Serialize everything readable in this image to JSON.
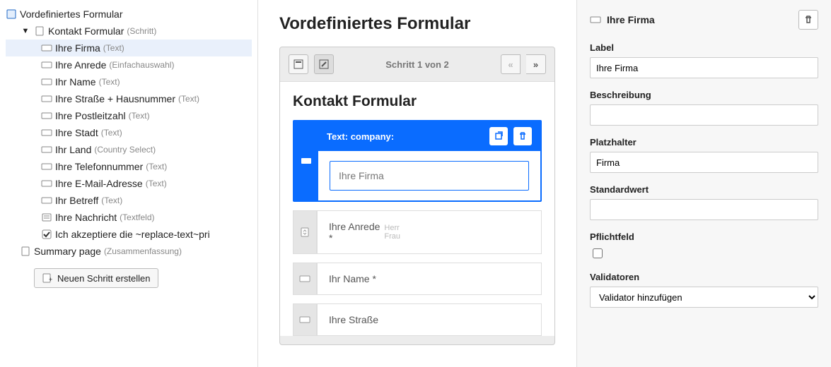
{
  "tree": {
    "root": {
      "label": "Vordefiniertes Formular",
      "type": ""
    },
    "step": {
      "label": "Kontakt Formular",
      "type": "(Schritt)"
    },
    "fields": [
      {
        "label": "Ihre Firma",
        "type": "(Text)",
        "icon": "field",
        "selected": true
      },
      {
        "label": "Ihre Anrede",
        "type": "(Einfachauswahl)",
        "icon": "field"
      },
      {
        "label": "Ihr Name",
        "type": "(Text)",
        "icon": "field"
      },
      {
        "label": "Ihre Straße + Hausnummer",
        "type": "(Text)",
        "icon": "field"
      },
      {
        "label": "Ihre Postleitzahl",
        "type": "(Text)",
        "icon": "field"
      },
      {
        "label": "Ihre Stadt",
        "type": "(Text)",
        "icon": "field"
      },
      {
        "label": "Ihr Land",
        "type": "(Country Select)",
        "icon": "field"
      },
      {
        "label": "Ihre Telefonnummer",
        "type": "(Text)",
        "icon": "field"
      },
      {
        "label": "Ihre E-Mail-Adresse",
        "type": "(Text)",
        "icon": "field"
      },
      {
        "label": "Ihr Betreff",
        "type": "(Text)",
        "icon": "field"
      },
      {
        "label": "Ihre Nachricht",
        "type": "(Textfeld)",
        "icon": "textarea"
      },
      {
        "label": "Ich akzeptiere die ~replace-text~pri",
        "type": "",
        "icon": "checkbox"
      }
    ],
    "summary": {
      "label": "Summary page",
      "type": "(Zusammenfassung)"
    },
    "create_step": "Neuen Schritt erstellen"
  },
  "preview": {
    "title": "Vordefiniertes Formular",
    "step_indicator": "Schritt 1 von 2",
    "subtitle": "Kontakt Formular",
    "selected_header": "Text: company:",
    "selected_placeholder": "Ihre Firma",
    "rows": [
      {
        "label": "Ihre Anrede",
        "req": "*",
        "hint1": "Herr",
        "hint2": "Frau"
      },
      {
        "label": "Ihr Name *",
        "req": ""
      },
      {
        "label": "Ihre Straße",
        "req": ""
      }
    ]
  },
  "inspector": {
    "title": "Ihre Firma",
    "labels": {
      "label": "Label",
      "desc": "Beschreibung",
      "placeholder": "Platzhalter",
      "default": "Standardwert",
      "required": "Pflichtfeld",
      "validators": "Validatoren"
    },
    "values": {
      "label": "Ihre Firma",
      "desc": "",
      "placeholder": "Firma",
      "default": ""
    },
    "validator_add": "Validator hinzufügen"
  }
}
